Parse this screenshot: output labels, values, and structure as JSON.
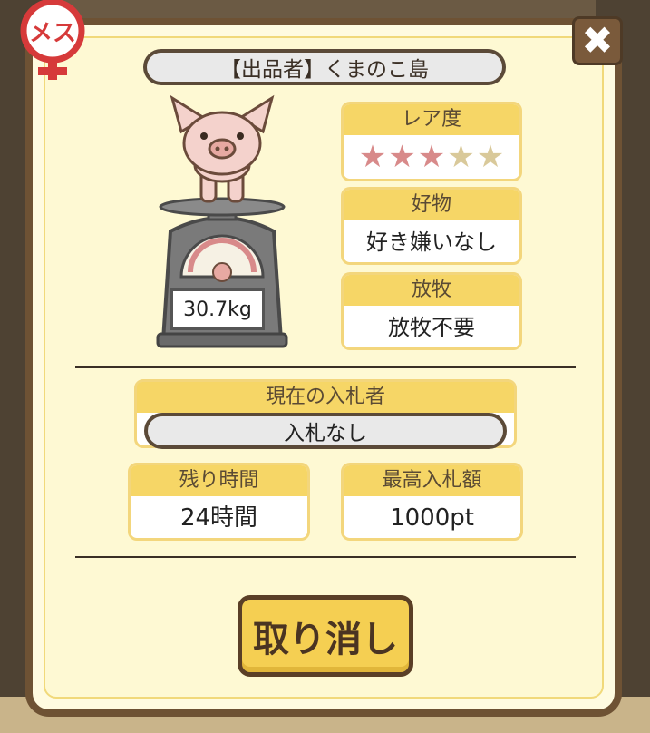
{
  "badge": {
    "gender_text": "メス"
  },
  "close_icon": "✖",
  "seller": {
    "label": "【出品者】くまのこ島"
  },
  "pig": {
    "weight": "30.7kg"
  },
  "rarity": {
    "label": "レア度",
    "stars_filled": 3,
    "stars_total": 5
  },
  "favorite": {
    "label": "好物",
    "value": "好き嫌いなし"
  },
  "grazing": {
    "label": "放牧",
    "value": "放牧不要"
  },
  "current_bidder": {
    "label": "現在の入札者",
    "value": "入札なし"
  },
  "remaining": {
    "label": "残り時間",
    "value": "24時間"
  },
  "max_bid": {
    "label": "最高入札額",
    "value": "1000pt"
  },
  "cancel_button": {
    "label": "取り消し"
  },
  "colors": {
    "accent": "#f6d666",
    "frame": "#6e5234",
    "panel": "#fef9d3",
    "star_on": "#d88a8a",
    "star_off": "#d9c99a"
  }
}
